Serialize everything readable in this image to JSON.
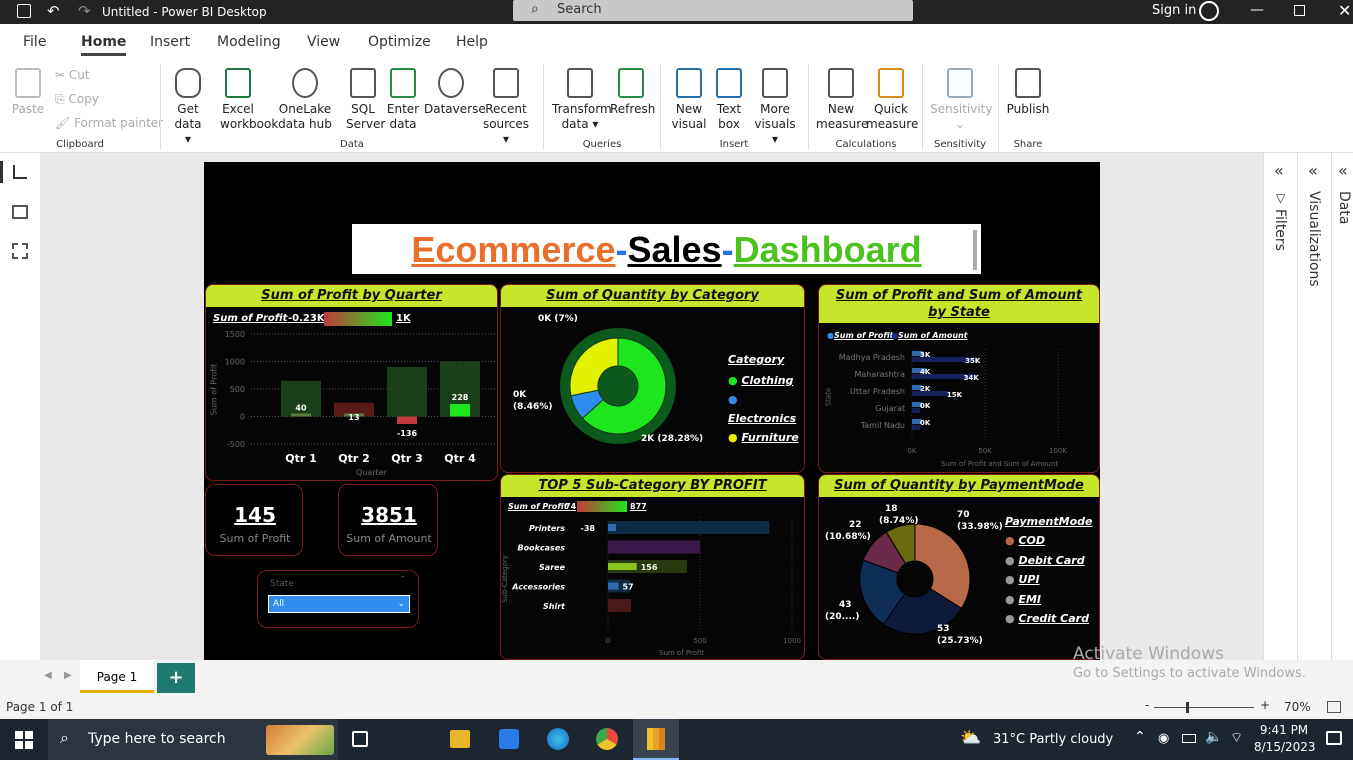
{
  "titlebar": {
    "title": "Untitled - Power BI Desktop",
    "search": "Search",
    "signin": "Sign in"
  },
  "menu": [
    "File",
    "Home",
    "Insert",
    "Modeling",
    "View",
    "Optimize",
    "Help"
  ],
  "ribbon": {
    "clipboard": {
      "paste": "Paste",
      "cut": "Cut",
      "copy": "Copy",
      "format": "Format painter",
      "group": "Clipboard"
    },
    "data": {
      "get": "Get data",
      "excel": "Excel workbook",
      "onelake": "OneLake data hub",
      "sql": "SQL Server",
      "enter": "Enter data",
      "dataverse": "Dataverse",
      "recent": "Recent sources",
      "group": "Data"
    },
    "queries": {
      "transform": "Transform data",
      "refresh": "Refresh",
      "group": "Queries"
    },
    "insert": {
      "newvisual": "New visual",
      "textbox": "Text box",
      "more": "More visuals",
      "group": "Insert"
    },
    "calc": {
      "newmeasure": "New measure",
      "quick": "Quick measure",
      "group": "Calculations"
    },
    "sens": {
      "label": "Sensitivity",
      "group": "Sensitivity"
    },
    "share": {
      "publish": "Publish",
      "group": "Share"
    }
  },
  "dashboard": {
    "title1": "Ecommerce",
    "dash1": "-",
    "title2": "Sales",
    "dash2": "-",
    "title3": "Dashboard",
    "profit_quarter": {
      "title": "Sum of Profit by Quarter",
      "legend": "Sum of Profit",
      "min": "-0.23K",
      "max": "1K",
      "yaxis": "Sum of Profit",
      "xaxis": "Quarter"
    },
    "qty_category": {
      "title": "Sum of Quantity by Category",
      "legend_title": "Category"
    },
    "profit_state": {
      "title": "Sum of Profit and Sum of Amount by State",
      "leg1": "Sum of Profit",
      "leg2": "Sum of Amount",
      "yaxis": "State",
      "xaxis": "Sum of Profit and Sum of Amount"
    },
    "top5": {
      "title": "TOP 5 Sub-Category BY PROFIT",
      "legend": "Sum of Profit",
      "min": "74",
      "max": "877",
      "yaxis": "Sub-Category",
      "xaxis": "Sum of Profit"
    },
    "payment": {
      "title": "Sum of Quantity by PaymentMode",
      "legend_title": "PaymentMode"
    },
    "card1": {
      "value": "145",
      "label": "Sum of Profit"
    },
    "card2": {
      "value": "3851",
      "label": "Sum of Amount"
    },
    "slicer": {
      "label": "State",
      "value": "All"
    }
  },
  "chart_data": [
    {
      "type": "bar",
      "title": "Sum of Profit by Quarter",
      "categories": [
        "Qtr 1",
        "Qtr 2",
        "Qtr 3",
        "Qtr 4"
      ],
      "values": [
        40,
        13,
        -136,
        228
      ],
      "ylim": [
        -500,
        1500
      ],
      "yticks": [
        "1500",
        "1000",
        "500",
        "0",
        "-500"
      ]
    },
    {
      "type": "pie",
      "title": "Sum of Quantity by Category",
      "labels": [
        "Clothing",
        "Electronics",
        "Furniture"
      ],
      "values": [
        63.26,
        8.46,
        28.28
      ],
      "label_text": [
        "2K (28.28%)",
        "0K (8.46%)",
        "0K (7%)"
      ],
      "colors": [
        "#1ee61e",
        "#2f8cf0",
        "#e3f000"
      ]
    },
    {
      "type": "bar",
      "title": "Sum of Profit and Sum of Amount by State",
      "categories": [
        "Madhya Pradesh",
        "Maharashtra",
        "Uttar Pradesh",
        "Gujarat",
        "Tamil Nadu"
      ],
      "series": [
        {
          "name": "Sum of Profit",
          "values": [
            3,
            4,
            2,
            0,
            0
          ]
        },
        {
          "name": "Sum of Amount",
          "values": [
            35,
            34,
            15,
            0,
            0
          ]
        }
      ],
      "profit_labels": [
        "3K",
        "4K",
        "2K",
        "0K",
        "0K"
      ],
      "amount_labels": [
        "35K",
        "34K",
        "15K"
      ],
      "xticks": [
        "0K",
        "50K",
        "100K"
      ]
    },
    {
      "type": "bar",
      "title": "TOP 5 Sub-Category BY PROFIT",
      "categories": [
        "Printers",
        "Bookcases",
        "Saree",
        "Accessories",
        "Shirt"
      ],
      "values": [
        -38,
        877,
        156,
        57,
        74
      ],
      "labels": [
        "-38",
        "",
        "156",
        "57",
        ""
      ],
      "xticks": [
        "0",
        "500",
        "1000"
      ]
    },
    {
      "type": "pie",
      "title": "Sum of Quantity by PaymentMode",
      "labels": [
        "COD",
        "Debit Card",
        "UPI",
        "EMI",
        "Credit Card"
      ],
      "values": [
        33.98,
        25.73,
        20.87,
        10.68,
        8.74
      ],
      "colors": [
        "#b8694a",
        "#0d1a3a",
        "#0f2e55",
        "#6b2a4a",
        "#6c6a10"
      ]
    }
  ],
  "category_legend": [
    "Clothing",
    "Electronics",
    "Furniture"
  ],
  "payment_legend": [
    "COD",
    "Debit Card",
    "UPI",
    "EMI",
    "Credit Card"
  ],
  "rightpanes": {
    "filters": "Filters",
    "viz": "Visualizations",
    "data": "Data"
  },
  "pages": {
    "tab": "Page 1",
    "add": "+"
  },
  "status": {
    "page": "Page 1 of 1",
    "zoom": "70%"
  },
  "watermark": {
    "line1": "Activate Windows",
    "line2": "Go to Settings to activate Windows."
  },
  "taskbar": {
    "search": "Type here to search",
    "weather": "31°C  Partly cloudy",
    "time": "9:41 PM",
    "date": "8/15/2023"
  }
}
